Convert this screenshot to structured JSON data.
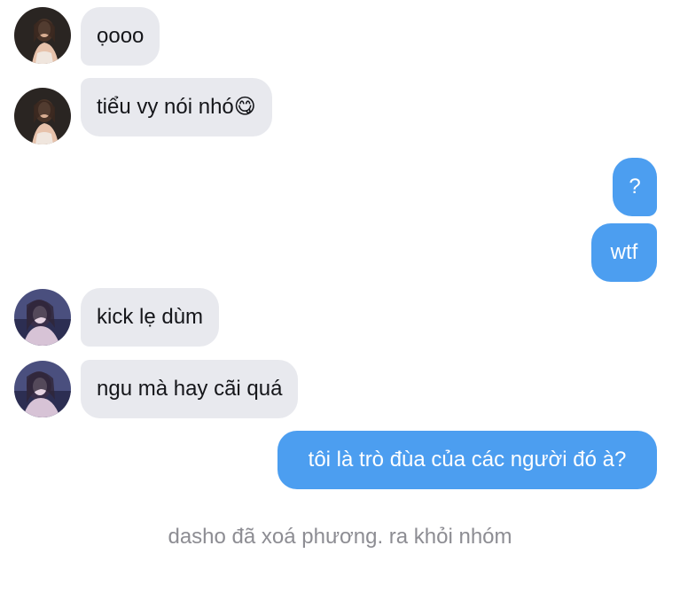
{
  "messages": [
    {
      "sender": "other",
      "avatar": "avatar-photo-woman-dark",
      "text": "ọooo"
    },
    {
      "sender": "other",
      "avatar": "avatar-photo-woman-dark",
      "text": "tiểu vy nói nhó😋"
    },
    {
      "sender": "me",
      "text": "?"
    },
    {
      "sender": "me",
      "text": "wtf"
    },
    {
      "sender": "other",
      "avatar": "avatar-photo-woman-purple",
      "text": "kick lẹ dùm"
    },
    {
      "sender": "other",
      "avatar": "avatar-photo-woman-purple",
      "text": "ngu mà hay cãi quá"
    },
    {
      "sender": "me",
      "text": "tôi là trò đùa của các người đó à?"
    }
  ],
  "system_note": "dasho đã xoá phương. ra khỏi nhóm",
  "colors": {
    "incoming_bubble": "#e8e9ee",
    "outgoing_bubble": "#4c9ef0",
    "system_text": "#8d8d93"
  }
}
